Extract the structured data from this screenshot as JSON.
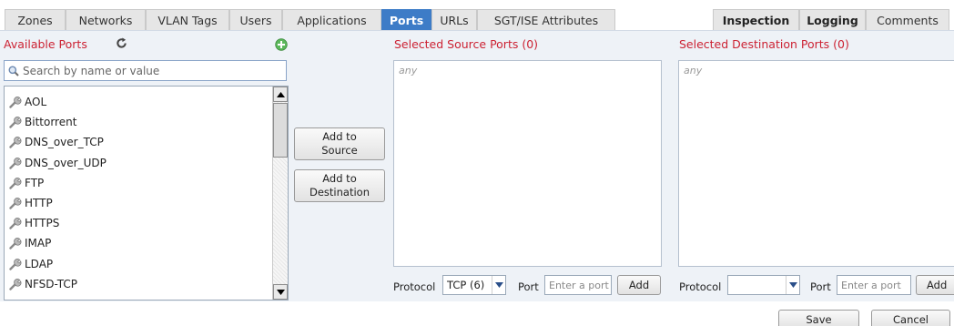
{
  "tabs": [
    {
      "label": "Zones"
    },
    {
      "label": "Networks"
    },
    {
      "label": "VLAN Tags"
    },
    {
      "label": "Users"
    },
    {
      "label": "Applications"
    },
    {
      "label": "Ports"
    },
    {
      "label": "URLs"
    },
    {
      "label": "SGT/ISE Attributes"
    },
    {
      "label": "Inspection"
    },
    {
      "label": "Logging"
    },
    {
      "label": "Comments"
    }
  ],
  "active_tab": "Ports",
  "available": {
    "title": "Available Ports",
    "search_placeholder": "Search by name or value",
    "items": [
      {
        "label": "AOL"
      },
      {
        "label": "Bittorrent"
      },
      {
        "label": "DNS_over_TCP"
      },
      {
        "label": "DNS_over_UDP"
      },
      {
        "label": "FTP"
      },
      {
        "label": "HTTP"
      },
      {
        "label": "HTTPS"
      },
      {
        "label": "IMAP"
      },
      {
        "label": "LDAP"
      },
      {
        "label": "NFSD-TCP"
      }
    ]
  },
  "buttons": {
    "add_to_source": "Add to\nSource",
    "add_to_destination": "Add to\nDestination",
    "save": "Save",
    "cancel": "Cancel"
  },
  "source": {
    "title": "Selected Source Ports (0)",
    "any": "any",
    "protocol_label": "Protocol",
    "protocol_value": "TCP (6)",
    "port_label": "Port",
    "port_placeholder": "Enter a port",
    "add_label": "Add"
  },
  "destination": {
    "title": "Selected Destination Ports (0)",
    "any": "any",
    "protocol_label": "Protocol",
    "protocol_value": "",
    "port_label": "Port",
    "port_placeholder": "Enter a port",
    "add_label": "Add"
  },
  "colors": {
    "active_tab": "#3d7cc7",
    "section_title": "#cc2233",
    "panel_bg": "#eef2f7"
  }
}
